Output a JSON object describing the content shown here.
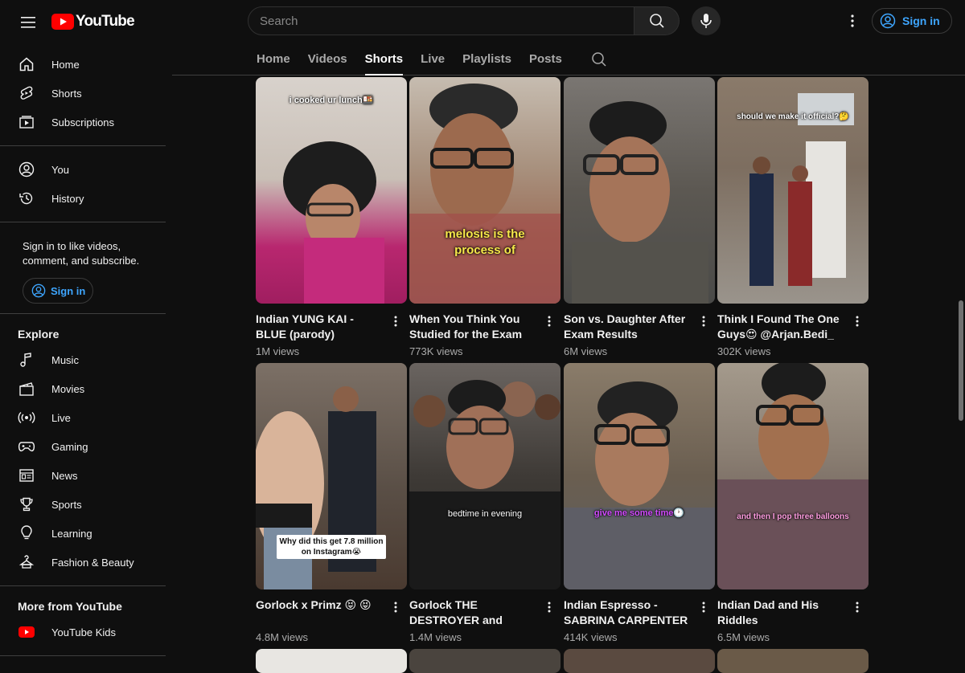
{
  "header": {
    "logo_text": "YouTube",
    "search_placeholder": "Search",
    "signin_label": "Sign in"
  },
  "sidebar": {
    "primary": [
      {
        "label": "Home",
        "icon": "home-icon"
      },
      {
        "label": "Shorts",
        "icon": "shorts-icon"
      },
      {
        "label": "Subscriptions",
        "icon": "subscriptions-icon"
      }
    ],
    "you": [
      {
        "label": "You",
        "icon": "account-icon"
      },
      {
        "label": "History",
        "icon": "history-icon"
      }
    ],
    "signin_note": "Sign in to like videos, comment, and subscribe.",
    "signin_label": "Sign in",
    "explore_heading": "Explore",
    "explore": [
      {
        "label": "Music",
        "icon": "music-icon"
      },
      {
        "label": "Movies",
        "icon": "movies-icon"
      },
      {
        "label": "Live",
        "icon": "live-icon"
      },
      {
        "label": "Gaming",
        "icon": "gaming-icon"
      },
      {
        "label": "News",
        "icon": "news-icon"
      },
      {
        "label": "Sports",
        "icon": "trophy-icon"
      },
      {
        "label": "Learning",
        "icon": "lightbulb-icon"
      },
      {
        "label": "Fashion & Beauty",
        "icon": "hanger-icon"
      }
    ],
    "more_heading": "More from YouTube",
    "more": [
      {
        "label": "YouTube Kids",
        "icon": "youtube-kids-icon"
      }
    ]
  },
  "tabs": [
    {
      "label": "Home",
      "active": false
    },
    {
      "label": "Videos",
      "active": false
    },
    {
      "label": "Shorts",
      "active": true
    },
    {
      "label": "Live",
      "active": false
    },
    {
      "label": "Playlists",
      "active": false
    },
    {
      "label": "Posts",
      "active": false
    }
  ],
  "shorts": [
    {
      "title": "Indian YUNG KAI - BLUE (parody)",
      "views": "1M views",
      "caption": "i cooked ur lunch🍱",
      "bg": "#b8276f"
    },
    {
      "title": "When You Think You Studied for the Exam",
      "views": "773K views",
      "caption": "melosis is the process of",
      "bg": "#7a5a4a"
    },
    {
      "title": "Son vs. Daughter After Exam Results",
      "views": "6M views",
      "caption": "",
      "bg": "#5c5a56"
    },
    {
      "title": "Think I Found The One Guys😍 @Arjan.Bedi_",
      "views": "302K views",
      "caption": "should we make it official?🤔",
      "bg": "#6e6258"
    },
    {
      "title": "Gorlock x Primz 😝 😝",
      "views": "4.8M views",
      "caption": "Why did this get 7.8 million on Instagram😭",
      "bg": "#4a4440"
    },
    {
      "title": "Gorlock THE DESTROYER and Brown Boys",
      "views": "1.4M views",
      "caption": "bedtime in evening",
      "bg": "#3a3634"
    },
    {
      "title": "Indian Espresso - SABRINA CARPENTER",
      "views": "414K views",
      "caption": "give me some time🕐",
      "bg": "#6a5e50"
    },
    {
      "title": "Indian Dad and His Riddles",
      "views": "6.5M views",
      "caption": "and then I pop three balloons",
      "bg": "#5a4a48"
    }
  ],
  "colors": {
    "brand_red": "#ff0000",
    "link_blue": "#3ea6ff",
    "background": "#0f0f0f"
  }
}
